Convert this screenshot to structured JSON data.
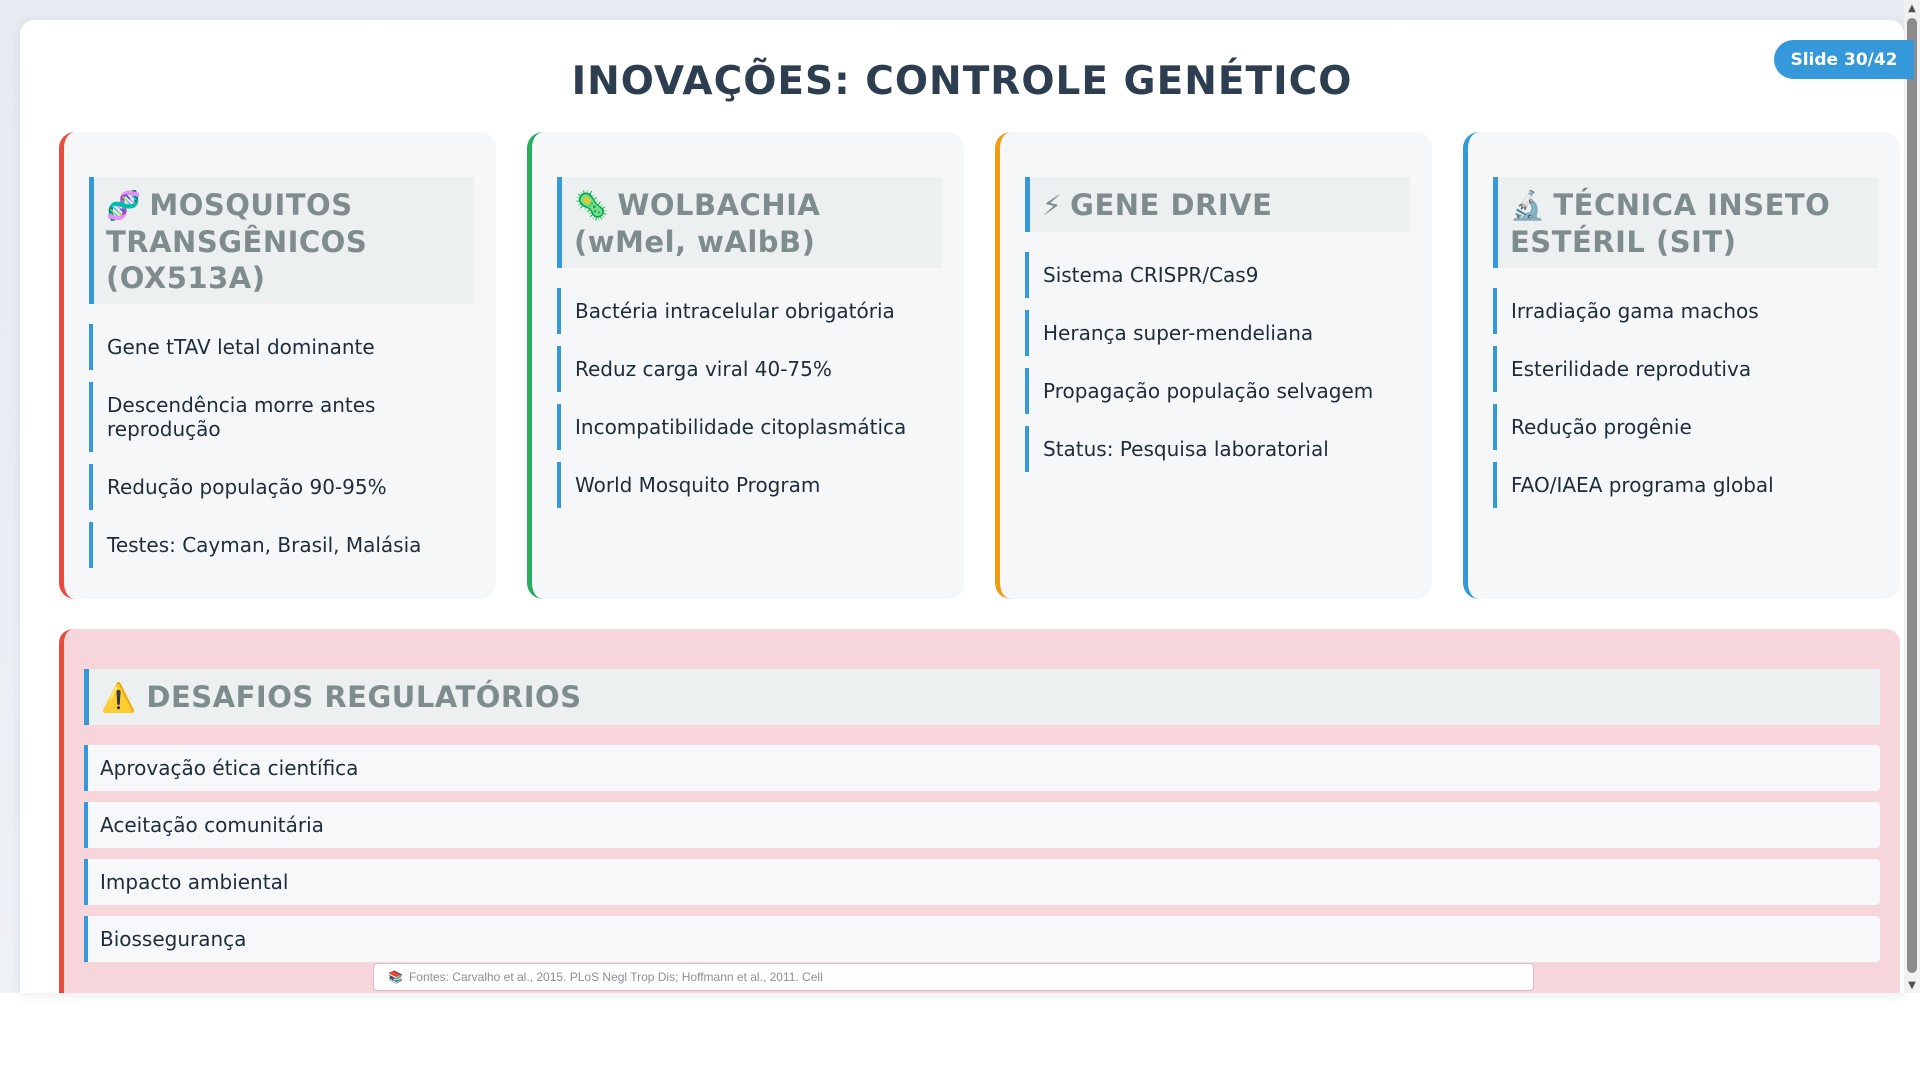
{
  "slide_badge": "Slide 30/42",
  "title": "INOVAÇÕES: CONTROLE GENÉTICO",
  "cards": [
    {
      "icon": "🧬",
      "icon_name": "dna-icon",
      "title": "MOSQUITOS TRANSGÊNICOS (OX513A)",
      "items": [
        "Gene tTAV letal dominante",
        "Descendência morre antes reprodução",
        "Redução população 90-95%",
        "Testes: Cayman, Brasil, Malásia"
      ]
    },
    {
      "icon": "🦠",
      "icon_name": "microbe-icon",
      "title": "WOLBACHIA (wMel, wAlbB)",
      "items": [
        "Bactéria intracelular obrigatória",
        "Reduz carga viral 40-75%",
        "Incompatibilidade citoplasmática",
        "World Mosquito Program"
      ]
    },
    {
      "icon": "⚡",
      "icon_name": "lightning-icon",
      "title": "GENE DRIVE",
      "items": [
        "Sistema CRISPR/Cas9",
        "Herança super-mendeliana",
        "Propagação população selvagem",
        "Status: Pesquisa laboratorial"
      ]
    },
    {
      "icon": "🔬",
      "icon_name": "microscope-icon",
      "title": "TÉCNICA INSETO ESTÉRIL (SIT)",
      "items": [
        "Irradiação gama machos",
        "Esterilidade reprodutiva",
        "Redução progênie",
        "FAO/IAEA programa global"
      ]
    }
  ],
  "challenges": {
    "icon": "⚠️",
    "icon_name": "warning-icon",
    "title": "DESAFIOS REGULATÓRIOS",
    "items": [
      "Aprovação ética científica",
      "Aceitação comunitária",
      "Impacto ambiental",
      "Biossegurança"
    ]
  },
  "sources": {
    "icon": "📚",
    "text": "Fontes: Carvalho et al., 2015. PLoS Negl Trop Dis; Hoffmann et al., 2011. Cell"
  },
  "colors": {
    "accent": "#3498db",
    "card1": "#e74c3c",
    "card2": "#27ae60",
    "card3": "#f39c12",
    "card4": "#3498db",
    "challenge_bg": "#f7d6db"
  }
}
